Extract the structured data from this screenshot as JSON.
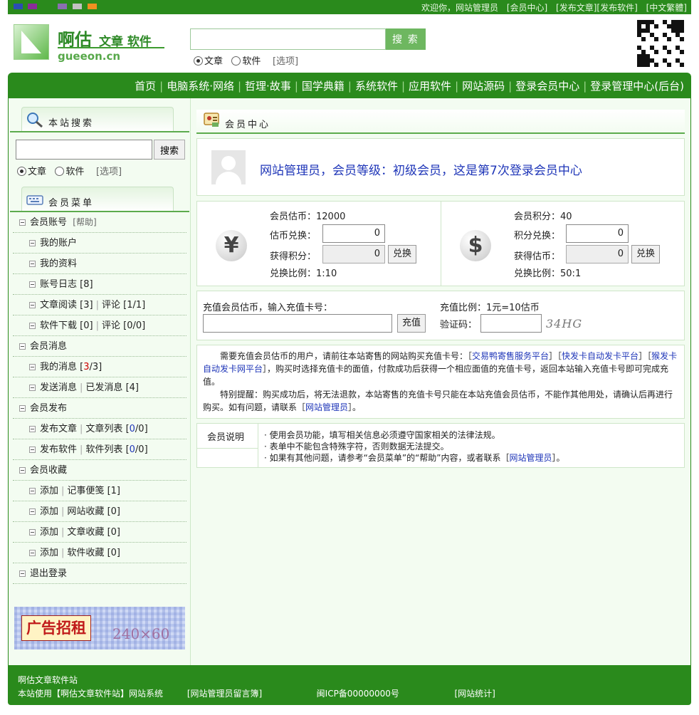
{
  "topbar": {
    "swatches": [
      "#2b4db3",
      "#8a2c9a",
      "#8a6fb0",
      "#c2c2c2",
      "#f09020"
    ],
    "welcome": "欢迎你，网站管理员",
    "member_center": "[会员中心]",
    "publish_article": "[发布文章]",
    "publish_software": "[发布软件]",
    "lang": "[中文繁體]"
  },
  "header": {
    "logo_cn": "啊估",
    "logo_sub": "文章 软件",
    "logo_en": "gueeon.cn",
    "search_button": "搜 索",
    "radio_article": "文章",
    "radio_software": "软件",
    "options": "[选项]"
  },
  "nav": {
    "items": [
      "首页",
      "电脑系统·网络",
      "哲理·故事",
      "国学典籍",
      "系统软件",
      "应用软件",
      "网站源码",
      "登录会员中心",
      "登录管理中心(后台)"
    ]
  },
  "left": {
    "search_title": "本站搜索",
    "search_button": "搜索",
    "radio_article": "文章",
    "radio_software": "软件",
    "options": "[选项]",
    "menu_title": "会员菜单",
    "menu": {
      "account": "会员账号",
      "help": "[帮助]",
      "my_account": "我的账户",
      "my_profile": "我的资料",
      "account_log": "账号日志",
      "account_log_count": "[8]",
      "article_read": "文章阅读",
      "article_read_count": "[3]",
      "comment": "评论",
      "comment1": "[1/1]",
      "software_dl": "软件下载",
      "software_dl_count": "[0]",
      "comment2": "[0/0]",
      "messages": "会员消息",
      "my_messages": "我的消息",
      "my_msg_open": "[",
      "my_msg_new": "3",
      "my_msg_rest": "/3]",
      "send_message": "发送消息",
      "sent_messages": "已发消息",
      "sent_count": "[4]",
      "publish": "会员发布",
      "publish_article": "发布文章",
      "article_list": "文章列表",
      "article_list_open": "[",
      "article_list_a": "0",
      "article_list_rest": "/0]",
      "publish_software": "发布软件",
      "software_list": "软件列表",
      "software_list_open": "[",
      "software_list_a": "0",
      "software_list_rest": "/0]",
      "favorites": "会员收藏",
      "add": "添加",
      "notes": "记事便笺",
      "notes_count": "[1]",
      "site_fav": "网站收藏",
      "site_fav_count": "[0]",
      "article_fav": "文章收藏",
      "article_fav_count": "[0]",
      "software_fav": "软件收藏",
      "software_fav_count": "[0]",
      "logout": "退出登录"
    },
    "ad_label": "广告招租",
    "ad_size": "240×60"
  },
  "main": {
    "title": "会员中心",
    "welcome": "网站管理员，会员等级：初级会员，这是第7次登录会员中心",
    "left_ex": {
      "coins_label": "会员估币：",
      "coins_value": "12000",
      "exchange_label": "估币兑换：",
      "exchange_value": "0",
      "get_label": "获得积分：",
      "get_value": "0",
      "button": "兑换",
      "ratio_label": "兑换比例：",
      "ratio_value": "1:10"
    },
    "right_ex": {
      "points_label": "会员积分：",
      "points_value": "40",
      "exchange_label": "积分兑换：",
      "exchange_value": "0",
      "get_label": "获得估币：",
      "get_value": "0",
      "button": "兑换",
      "ratio_label": "兑换比例：",
      "ratio_value": "50:1"
    },
    "recharge": {
      "label": "充值会员估币，输入充值卡号：",
      "button": "充值",
      "ratio": "充值比例：1元=10估币",
      "captcha_label": "验证码：",
      "captcha": "34HG"
    },
    "notice": {
      "p1_a": "需要充值会员估币的用户，请前往本站寄售的网站购买充值卡号：［",
      "link1": "交易鸭寄售服务平台",
      "p1_b": "］［",
      "link2": "快发卡自动发卡平台",
      "p1_c": "］［",
      "link3": "猴发卡自动发卡网平台",
      "p1_d": "］，购买时选择充值卡的面值，付款成功后获得一个相应面值的充值卡号，返回本站输入充值卡号即可完成充值。",
      "p2_a": "特别提醒：购买成功后，将无法退款，本站寄售的充值卡号只能在本站充值会员估币，不能作其他用处，请确认后再进行购买。如有问题，请联系［",
      "link4": "网站管理员",
      "p2_b": "］。"
    },
    "info": {
      "header": "会员说明",
      "line1": "· 使用会员功能，填写相关信息必须遵守国家相关的法律法规。",
      "line2": "· 表单中不能包含特殊字符，否则数据无法提交。",
      "line3_a": "· 如果有其他问题，请参考“会员菜单”的“帮助”内容，或者联系［",
      "line3_link": "网站管理员",
      "line3_b": "］。"
    }
  },
  "footer": {
    "line1": "啊估文章软件站",
    "system": "本站使用【啊估文章软件站】网站系统",
    "guestbook": "[网站管理员留言簿]",
    "icp": "闽ICP备00000000号",
    "stats": "[网站统计]"
  }
}
